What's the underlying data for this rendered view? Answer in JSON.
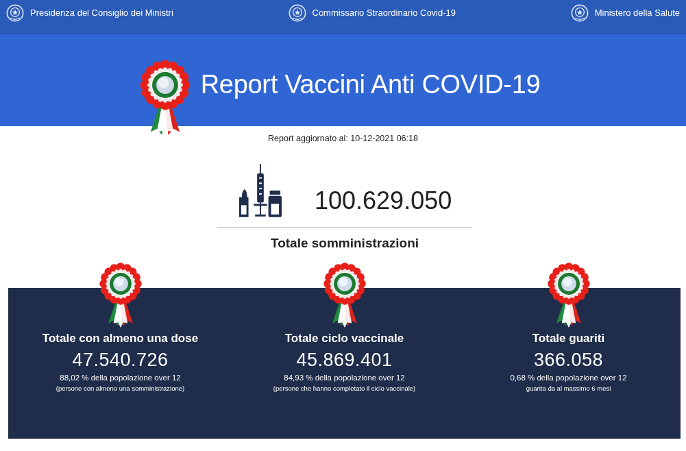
{
  "top_bar": [
    {
      "label": "Presidenza del Consiglio dei Ministri"
    },
    {
      "label": "Commissario Straordinario Covid-19"
    },
    {
      "label": "Ministero della Salute"
    }
  ],
  "header": {
    "title": "Report Vaccini Anti COVID-19"
  },
  "updated": "Report aggiornato al: 10-12-2021 06:18",
  "total": {
    "value": "100.629.050",
    "label": "Totale somministrazioni"
  },
  "cards": [
    {
      "title": "Totale con almeno una dose",
      "value": "47.540.726",
      "percent": "88,02 % della popolazione over 12",
      "note": "(persone con almeno una somministrazione)"
    },
    {
      "title": "Totale ciclo vaccinale",
      "value": "45.869.401",
      "percent": "84,93 % della popolazione over 12",
      "note": "(persone che hanno completato il ciclo vaccinale)"
    },
    {
      "title": "Totale guariti",
      "value": "366.058",
      "percent": "0,68 % della popolazione over 12",
      "note": "guarita da al massimo 6 mesi"
    }
  ]
}
